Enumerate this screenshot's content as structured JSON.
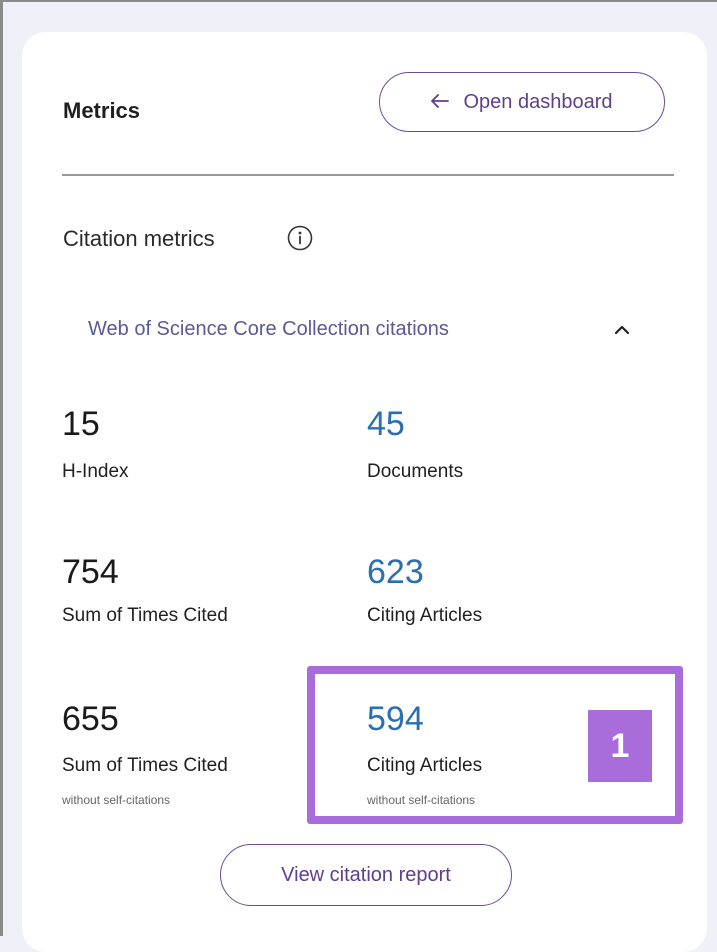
{
  "panel": {
    "title": "Metrics",
    "open_dashboard_label": "Open dashboard",
    "citation_metrics_label": "Citation metrics",
    "collection_label": "Web of Science Core Collection citations",
    "view_report_label": "View citation report",
    "annotation_badge": "1"
  },
  "metrics": [
    {
      "value": "15",
      "label": "H-Index",
      "sub": ""
    },
    {
      "value": "45",
      "label": "Documents",
      "sub": ""
    },
    {
      "value": "754",
      "label": "Sum of Times Cited",
      "sub": ""
    },
    {
      "value": "623",
      "label": "Citing Articles",
      "sub": ""
    },
    {
      "value": "655",
      "label": "Sum of Times Cited",
      "sub": "without self-citations"
    },
    {
      "value": "594",
      "label": "Citing Articles",
      "sub": "without self-citations"
    }
  ],
  "icons": {
    "arrow": "arrow-left-icon",
    "info": "info-icon",
    "collapse": "chevron-up-icon"
  },
  "colors": {
    "accent_purple": "#5e3f8c",
    "link_blue": "#2a6fb0",
    "highlight": "#a86cdb"
  }
}
